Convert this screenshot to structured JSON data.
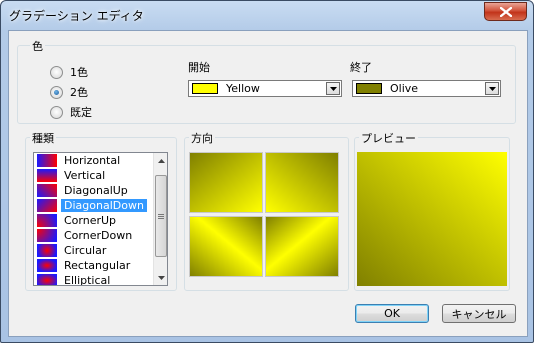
{
  "window": {
    "title": "グラデーション エディタ"
  },
  "color_group": {
    "label": "色",
    "options": [
      {
        "label": "1色",
        "checked": false
      },
      {
        "label": "2色",
        "checked": true
      },
      {
        "label": "既定",
        "checked": false
      }
    ]
  },
  "start": {
    "label": "開始",
    "value": "Yellow",
    "swatch": "#ffff00"
  },
  "end": {
    "label": "終了",
    "value": "Olive",
    "swatch": "#808000"
  },
  "type_group": {
    "label": "種類",
    "items": [
      "Horizontal",
      "Vertical",
      "DiagonalUp",
      "DiagonalDown",
      "CornerUp",
      "CornerDown",
      "Circular",
      "Rectangular",
      "Elliptical"
    ],
    "selected": "DiagonalDown"
  },
  "direction_group": {
    "label": "方向"
  },
  "preview_group": {
    "label": "プレビュー"
  },
  "buttons": {
    "ok": "OK",
    "cancel": "キャンセル"
  },
  "colors": {
    "yellow": "#ffff00",
    "olive": "#808000",
    "selection": "#3399ff"
  }
}
